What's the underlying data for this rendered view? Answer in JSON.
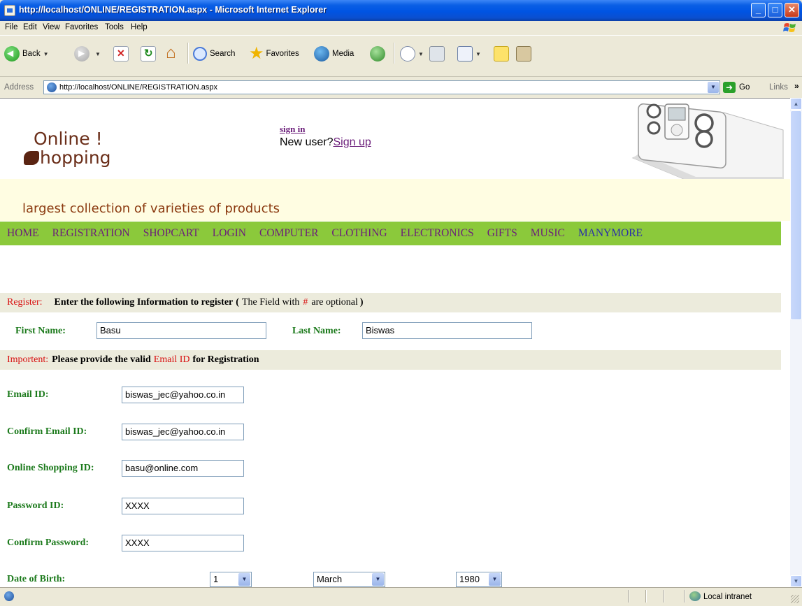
{
  "window": {
    "title": "http://localhost/ONLINE/REGISTRATION.aspx - Microsoft Internet Explorer"
  },
  "menu": [
    "File",
    "Edit",
    "View",
    "Favorites",
    "Tools",
    "Help"
  ],
  "toolbar": {
    "back": "Back",
    "search": "Search",
    "favorites": "Favorites",
    "media": "Media"
  },
  "address": {
    "label": "Address",
    "url": "http://localhost/ONLINE/REGISTRATION.aspx",
    "go": "Go",
    "links": "Links"
  },
  "page": {
    "logo_line1": "Online !",
    "logo_line2": "hopping",
    "signin": "sign in",
    "new_user": "New user?",
    "signup": "Sign up",
    "tagline": "largest collection of varieties of products",
    "nav": [
      "HOME",
      "REGISTRATION",
      "SHOPCART",
      "LOGIN",
      "COMPUTER",
      "CLOTHING",
      "ELECTRONICS",
      "GIFTS",
      "MUSIC",
      "MANYMORE"
    ],
    "register": {
      "label": "Register:",
      "text1": "Enter the following Information to register",
      "paren_open": "(",
      "text2": "The Field with",
      "hash": "#",
      "text3": "are optional",
      "paren_close": ")"
    },
    "important": {
      "label": "Importent:",
      "text1": "Please provide the valid",
      "email": "Email ID",
      "text2": "for Registration"
    },
    "fields": {
      "first_name_label": "First Name:",
      "first_name": "Basu",
      "last_name_label": "Last Name:",
      "last_name": "Biswas",
      "email_label": "Email ID:",
      "email": "biswas_jec@yahoo.co.in",
      "confirm_email_label": "Confirm Email ID:",
      "confirm_email": "biswas_jec@yahoo.co.in",
      "shopping_id_label": "Online Shopping ID:",
      "shopping_id": "basu@online.com",
      "password_label": "Password ID:",
      "password": "XXXX",
      "confirm_password_label": "Confirm Password:",
      "confirm_password": "XXXX",
      "dob_label": "Date of Birth:",
      "dob_day": "1",
      "dob_month": "March",
      "dob_year": "1980"
    }
  },
  "status": {
    "zone": "Local intranet"
  }
}
